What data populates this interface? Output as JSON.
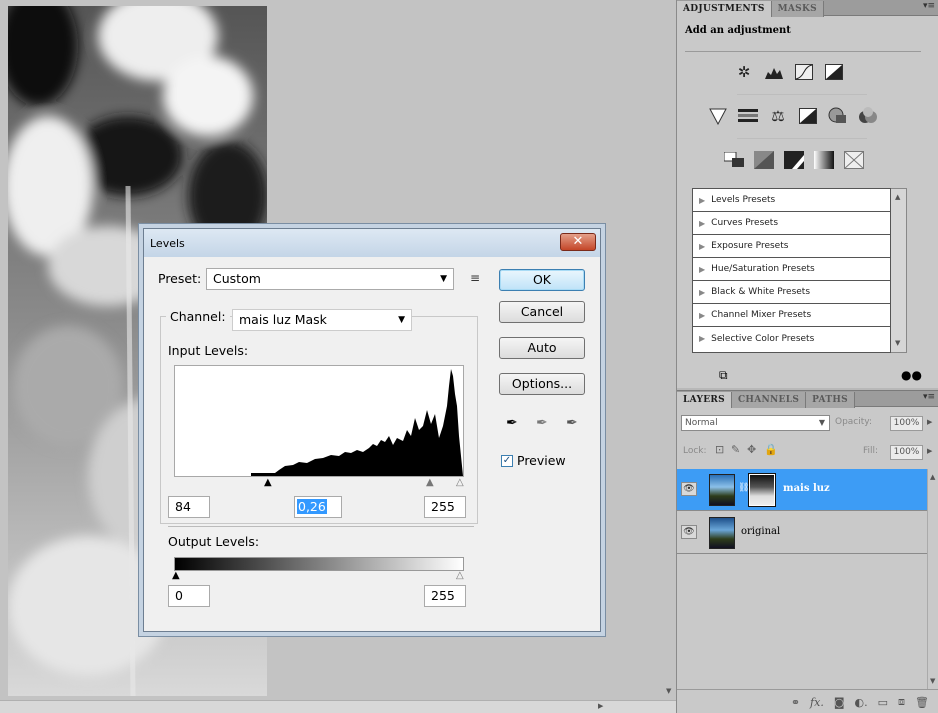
{
  "adjustments_panel": {
    "tabs": [
      "ADJUSTMENTS",
      "MASKS"
    ],
    "title": "Add an adjustment",
    "icons_row1": [
      "brightness-contrast-icon",
      "levels-icon",
      "curves-icon",
      "exposure-icon"
    ],
    "icons_row2": [
      "vibrance-icon",
      "hue-saturation-icon",
      "color-balance-icon",
      "black-white-icon",
      "photo-filter-icon",
      "channel-mixer-icon"
    ],
    "icons_row3": [
      "invert-icon",
      "posterize-icon",
      "threshold-icon",
      "gradient-map-icon",
      "selective-color-icon"
    ],
    "presets": [
      "Levels Presets",
      "Curves Presets",
      "Exposure Presets",
      "Hue/Saturation Presets",
      "Black & White Presets",
      "Channel Mixer Presets",
      "Selective Color Presets"
    ]
  },
  "layers_panel": {
    "tabs": [
      "LAYERS",
      "CHANNELS",
      "PATHS"
    ],
    "blend_mode": "Normal",
    "opacity_label": "Opacity:",
    "opacity": "100%",
    "lock_label": "Lock:",
    "fill_label": "Fill:",
    "fill": "100%",
    "layers": [
      {
        "name": "mais luz",
        "selected": true
      },
      {
        "name": "original",
        "selected": false
      }
    ]
  },
  "levels_dialog": {
    "title": "Levels",
    "preset_label": "Preset:",
    "preset_value": "Custom",
    "channel_label": "Channel:",
    "channel_value": "mais luz Mask",
    "input_levels_label": "Input Levels:",
    "input_black": "84",
    "input_gamma": "0,26",
    "input_white": "255",
    "output_levels_label": "Output Levels:",
    "output_black": "0",
    "output_white": "255",
    "ok_label": "OK",
    "cancel_label": "Cancel",
    "auto_label": "Auto",
    "options_label": "Options...",
    "preview_label": "Preview",
    "preview_checked": true
  }
}
